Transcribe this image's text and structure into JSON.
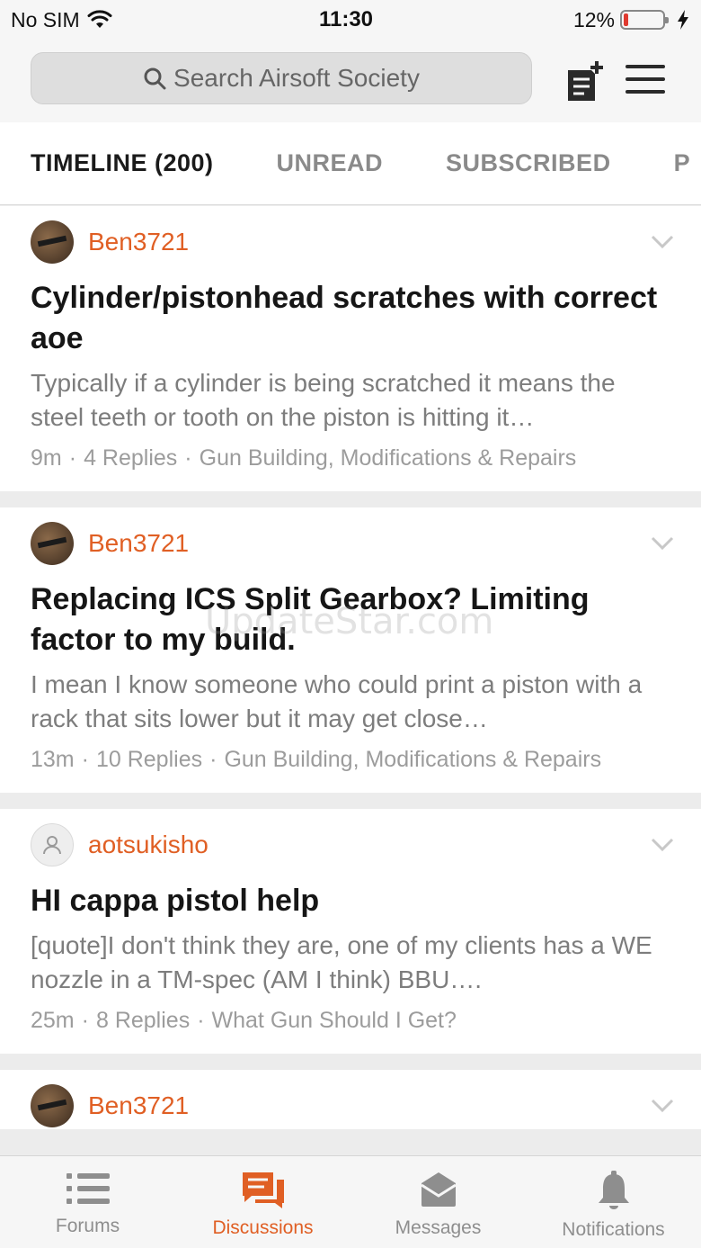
{
  "status_bar": {
    "carrier": "No SIM",
    "time": "11:30",
    "battery_percent": "12%",
    "battery_level": 0.12
  },
  "search": {
    "placeholder": "Search Airsoft Society"
  },
  "tabs": [
    {
      "label": "TIMELINE (200)",
      "active": true
    },
    {
      "label": "UNREAD",
      "active": false
    },
    {
      "label": "SUBSCRIBED",
      "active": false
    },
    {
      "label": "P",
      "active": false
    }
  ],
  "threads": [
    {
      "author": "Ben3721",
      "avatar": "photo",
      "title": "Cylinder/pistonhead scratches with correct aoe",
      "snippet": "Typically if a cylinder is being scratched it means the steel teeth or tooth on the piston is hitting it…",
      "time": "9m",
      "replies": "4 Replies",
      "forum": "Gun Building, Modifications & Repairs"
    },
    {
      "author": "Ben3721",
      "avatar": "photo",
      "title": "Replacing ICS Split Gearbox? Limiting factor to my build.",
      "snippet": "I mean I know someone who could print a piston with a rack that sits lower but it may get close…",
      "time": "13m",
      "replies": "10 Replies",
      "forum": "Gun Building, Modifications & Repairs"
    },
    {
      "author": "aotsukisho",
      "avatar": "default",
      "title": "HI cappa pistol help",
      "snippet": "[quote]I don't think they are, one of my clients has a WE nozzle in a TM-spec (AM I think) BBU….",
      "time": "25m",
      "replies": "8 Replies",
      "forum": "What Gun Should I Get?"
    },
    {
      "author": "Ben3721",
      "avatar": "photo",
      "title": "",
      "snippet": "",
      "time": "",
      "replies": "",
      "forum": ""
    }
  ],
  "bottom_nav": [
    {
      "label": "Forums",
      "icon": "list-icon",
      "active": false
    },
    {
      "label": "Discussions",
      "icon": "chat-bubbles-icon",
      "active": true
    },
    {
      "label": "Messages",
      "icon": "envelope-icon",
      "active": false
    },
    {
      "label": "Notifications",
      "icon": "bell-icon",
      "active": false
    }
  ],
  "watermark": "UpdateStar.com",
  "colors": {
    "accent": "#e05f24",
    "muted_text": "#7d7d7d",
    "battery_low": "#e03a2f"
  }
}
